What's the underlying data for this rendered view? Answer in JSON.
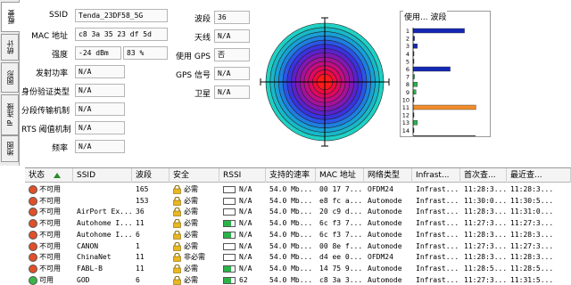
{
  "tabs": [
    {
      "label": "概要",
      "active": true
    },
    {
      "label": "统计",
      "active": false
    },
    {
      "label": "图形",
      "active": false
    },
    {
      "label": "IP 连接",
      "active": false
    },
    {
      "label": "地图",
      "active": false
    }
  ],
  "info": [
    {
      "label": "SSID",
      "value": "Tenda_23DF58_5G"
    },
    {
      "label": "MAC 地址",
      "value": "c8 3a 35 23 df 5d"
    },
    {
      "label": "强度",
      "value": "-24 dBm",
      "value2": "83 %"
    },
    {
      "label": "发射功率",
      "value": "N/A"
    },
    {
      "label": "身份验证类型",
      "value": "N/A"
    },
    {
      "label": "分段传输机制",
      "value": "N/A"
    },
    {
      "label": "RTS 阈值机制",
      "value": "N/A"
    },
    {
      "label": "频率",
      "value": "N/A"
    }
  ],
  "info_right": [
    {
      "label": "波段",
      "value": "36"
    },
    {
      "label": "天线",
      "value": "N/A"
    },
    {
      "label": "使用 GPS",
      "value": "否"
    },
    {
      "label": "GPS 信号",
      "value": "N/A"
    },
    {
      "label": "卫星",
      "value": "N/A"
    }
  ],
  "usage": {
    "title": "使用... 波段",
    "channels": [
      "1",
      "2",
      "3",
      "4",
      "5",
      "6",
      "7",
      "8",
      "9",
      "10",
      "11",
      "12",
      "13",
      "14"
    ],
    "values": [
      36,
      1,
      3,
      0,
      0,
      26,
      1,
      3,
      2,
      0,
      44,
      0,
      3,
      0
    ],
    "colors": [
      "#1428b4",
      "#1428b4",
      "#1428b4",
      "#1428b4",
      "#1428b4",
      "#1428b4",
      "#2bb34a",
      "#2bb34a",
      "#2bb34a",
      "#1428b4",
      "#f08c2a",
      "#1428b4",
      "#2bb34a",
      "#1428b4"
    ]
  },
  "table": {
    "columns": [
      "状态",
      "SSID",
      "波段",
      "安全",
      "RSSI",
      "支持的速率",
      "MAC 地址",
      "网络类型",
      "Infrast...",
      "首次查...",
      "最近查..."
    ],
    "rows": [
      {
        "status": "不可用",
        "ssid": "",
        "channel": "165",
        "security": "必需",
        "rssi": "N/A",
        "rssi_level": 0,
        "rate": "54.0 Mb...",
        "mac": "00 17 7...",
        "nettype": "OFDM24",
        "infra": "Infrast...",
        "first": "11:28:3...",
        "last": "11:28:3..."
      },
      {
        "status": "不可用",
        "ssid": "",
        "channel": "153",
        "security": "必需",
        "rssi": "N/A",
        "rssi_level": 0,
        "rate": "54.0 Mb...",
        "mac": "e8 fc a...",
        "nettype": "Automode",
        "infra": "Infrast...",
        "first": "11:30:0...",
        "last": "11:30:5..."
      },
      {
        "status": "不可用",
        "ssid": "AirPort Ex...",
        "channel": "36",
        "security": "必需",
        "rssi": "N/A",
        "rssi_level": 0,
        "rate": "54.0 Mb...",
        "mac": "20 c9 d...",
        "nettype": "Automode",
        "infra": "Infrast...",
        "first": "11:28:3...",
        "last": "11:31:0..."
      },
      {
        "status": "不可用",
        "ssid": "Autohome I...",
        "channel": "11",
        "security": "必需",
        "rssi": "N/A",
        "rssi_level": 0.7,
        "rate": "54.0 Mb...",
        "mac": "6c f3 7...",
        "nettype": "Automode",
        "infra": "Infrast...",
        "first": "11:27:3...",
        "last": "11:27:3..."
      },
      {
        "status": "不可用",
        "ssid": "Autohome I...",
        "channel": "6",
        "security": "必需",
        "rssi": "N/A",
        "rssi_level": 0.7,
        "rate": "54.0 Mb...",
        "mac": "6c f3 7...",
        "nettype": "Automode",
        "infra": "Infrast...",
        "first": "11:28:3...",
        "last": "11:28:3..."
      },
      {
        "status": "不可用",
        "ssid": "CANON",
        "channel": "1",
        "security": "必需",
        "rssi": "N/A",
        "rssi_level": 0,
        "rate": "54.0 Mb...",
        "mac": "00 8e f...",
        "nettype": "Automode",
        "infra": "Infrast...",
        "first": "11:27:3...",
        "last": "11:27:3..."
      },
      {
        "status": "不可用",
        "ssid": "ChinaNet",
        "channel": "11",
        "security": "非必需",
        "rssi": "N/A",
        "rssi_level": 0,
        "rate": "54.0 Mb...",
        "mac": "d4 ee 0...",
        "nettype": "OFDM24",
        "infra": "Infrast...",
        "first": "11:28:3...",
        "last": "11:28:3..."
      },
      {
        "status": "不可用",
        "ssid": "FABL-B",
        "channel": "11",
        "security": "必需",
        "rssi": "N/A",
        "rssi_level": 0.7,
        "rate": "54.0 Mb...",
        "mac": "14 75 9...",
        "nettype": "Automode",
        "infra": "Infrast...",
        "first": "11:28:5...",
        "last": "11:28:5..."
      },
      {
        "status": "可用",
        "ssid": "GOD",
        "channel": "6",
        "security": "必需",
        "rssi": "62",
        "rssi_level": 0.7,
        "rate": "54.0 Mb...",
        "mac": "c8 3a 3...",
        "nettype": "Automode",
        "infra": "Infrast...",
        "first": "11:27:3...",
        "last": "11:31:5..."
      }
    ]
  },
  "colors": {
    "unavailable": "#e0502a",
    "available": "#39b54a",
    "lock": "#e8b722",
    "accent_green": "#2bb34a"
  }
}
